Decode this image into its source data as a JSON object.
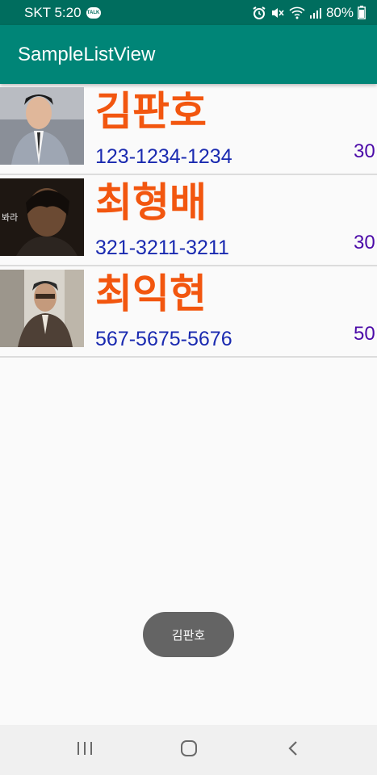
{
  "status_bar": {
    "carrier_time": "SKT 5:20",
    "talk_badge": "TALK",
    "battery": "80%"
  },
  "app_bar": {
    "title": "SampleListView"
  },
  "list": [
    {
      "name": "김판호",
      "phone": "123-1234-1234",
      "age": "30"
    },
    {
      "name": "최형배",
      "phone": "321-3211-3211",
      "age": "30"
    },
    {
      "name": "최익현",
      "phone": "567-5675-5676",
      "age": "50"
    }
  ],
  "toast": {
    "text": "김판호"
  },
  "colors": {
    "status_bar": "#006d5e",
    "app_bar": "#008577",
    "name": "#f2560f",
    "phone": "#1a2ab0",
    "age": "#4b0aa8",
    "toast": "#646464"
  },
  "nav_icons": [
    "recent-apps-icon",
    "home-icon",
    "back-icon"
  ]
}
